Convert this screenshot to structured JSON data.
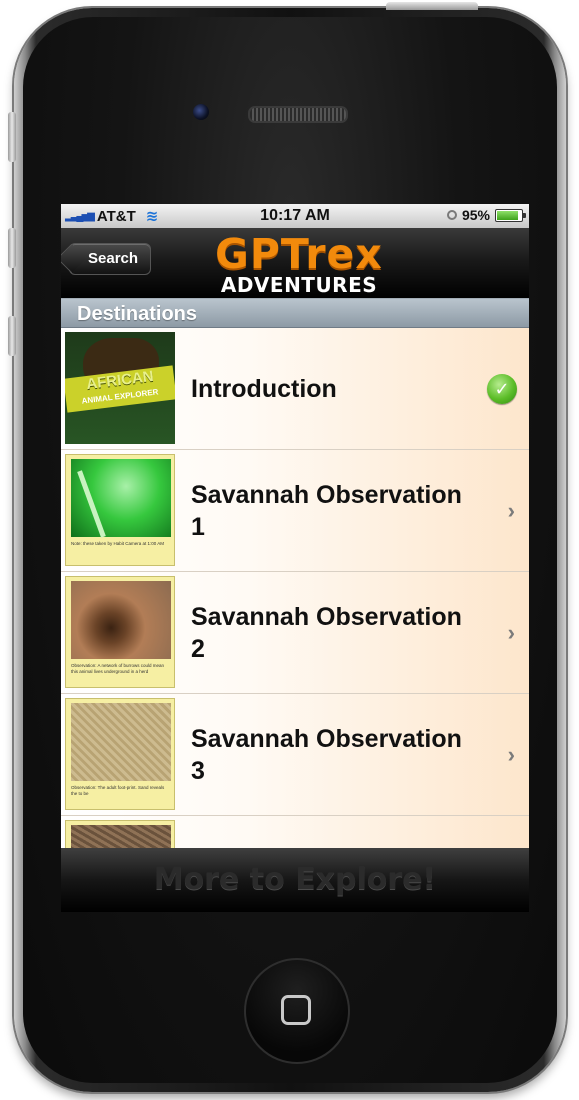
{
  "status_bar": {
    "carrier": "AT&T",
    "time": "10:17 AM",
    "battery_percent": "95%",
    "signal_icon": "signal-bars-icon",
    "wifi_icon": "wifi-icon",
    "battery_icon": "battery-icon"
  },
  "nav": {
    "back_label": "Search",
    "logo_top": "GPTrex",
    "logo_bottom": "ADVENTURES"
  },
  "section": {
    "title": "Destinations"
  },
  "rows": [
    {
      "title": "Introduction",
      "thumb_text": "AFRICAN",
      "thumb_subtext": "ANIMAL EXPLORER",
      "accessory": "checkmark-icon"
    },
    {
      "title": "Savannah Observation 1",
      "caption": "Note: these taken by Habit Camera at 1:00 AM",
      "accessory": "chevron-right-icon"
    },
    {
      "title": "Savannah Observation 2",
      "caption": "Observation: A network of burrows could mean this animal lives underground in a herd",
      "accessory": "chevron-right-icon"
    },
    {
      "title": "Savannah Observation 3",
      "caption": "Observation: The adult foot-print. Sand reveals the to be",
      "accessory": "chevron-right-icon"
    }
  ],
  "toolbar": {
    "label": "More to Explore!"
  },
  "colors": {
    "logo_orange": "#f28a0c",
    "section_header": "#9aa6b1",
    "check_green": "#5cbd28"
  }
}
